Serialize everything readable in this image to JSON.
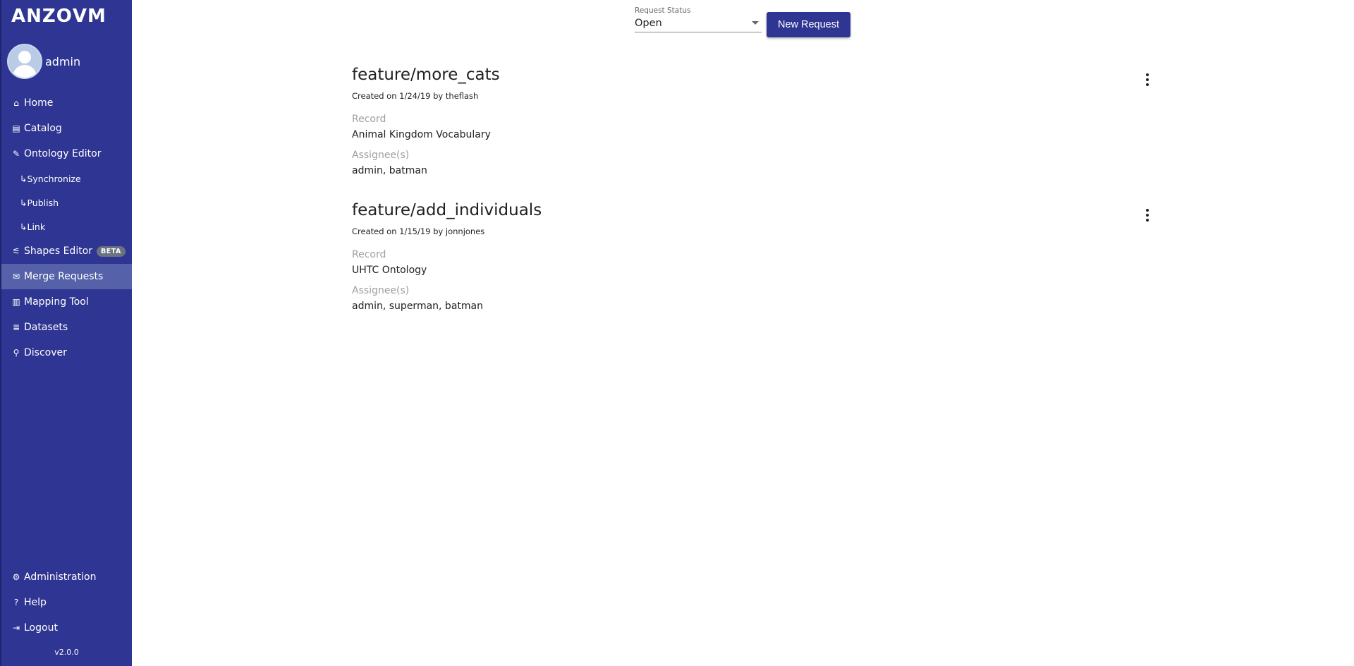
{
  "app": {
    "logo": "ANZO",
    "logo_suffix": "VM",
    "version": "v2.0.0"
  },
  "user": {
    "name": "admin"
  },
  "sidebar": {
    "items": [
      {
        "label": "Home",
        "icon": "home-icon",
        "glyph": "⌂"
      },
      {
        "label": "Catalog",
        "icon": "book-icon",
        "glyph": "▤"
      },
      {
        "label": "Ontology Editor",
        "icon": "edit-icon",
        "glyph": "✎"
      },
      {
        "label": "↳Synchronize"
      },
      {
        "label": "↳Publish"
      },
      {
        "label": "↳Link"
      },
      {
        "label": "Shapes Editor",
        "icon": "shapes-icon",
        "glyph": "⚟",
        "badge": "BETA"
      },
      {
        "label": "Merge Requests",
        "icon": "envelope-icon",
        "glyph": "✉"
      },
      {
        "label": "Mapping Tool",
        "icon": "map-icon",
        "glyph": "▥"
      },
      {
        "label": "Datasets",
        "icon": "database-icon",
        "glyph": "≣"
      },
      {
        "label": "Discover",
        "icon": "search-icon",
        "glyph": "⚲"
      }
    ],
    "bottom": [
      {
        "label": "Administration",
        "icon": "gear-icon",
        "glyph": "⚙"
      },
      {
        "label": "Help",
        "icon": "question-icon",
        "glyph": "?"
      },
      {
        "label": "Logout",
        "icon": "logout-icon",
        "glyph": "⇥"
      }
    ]
  },
  "toolbar": {
    "status_label": "Request Status",
    "status_value": "Open",
    "new_request_label": "New Request"
  },
  "requests": [
    {
      "title": "feature/more_cats",
      "meta": "Created on 1/24/19 by theflash",
      "record_label": "Record",
      "record": "Animal Kingdom Vocabulary",
      "assignees_label": "Assignee(s)",
      "assignees": "admin, batman"
    },
    {
      "title": "feature/add_individuals",
      "meta": "Created on 1/15/19 by jonnjones",
      "record_label": "Record",
      "record": "UHTC Ontology",
      "assignees_label": "Assignee(s)",
      "assignees": "admin, superman, batman"
    }
  ],
  "colors": {
    "sidebar": "#2f3592",
    "active": "#5561a8",
    "button": "#2f3592"
  }
}
